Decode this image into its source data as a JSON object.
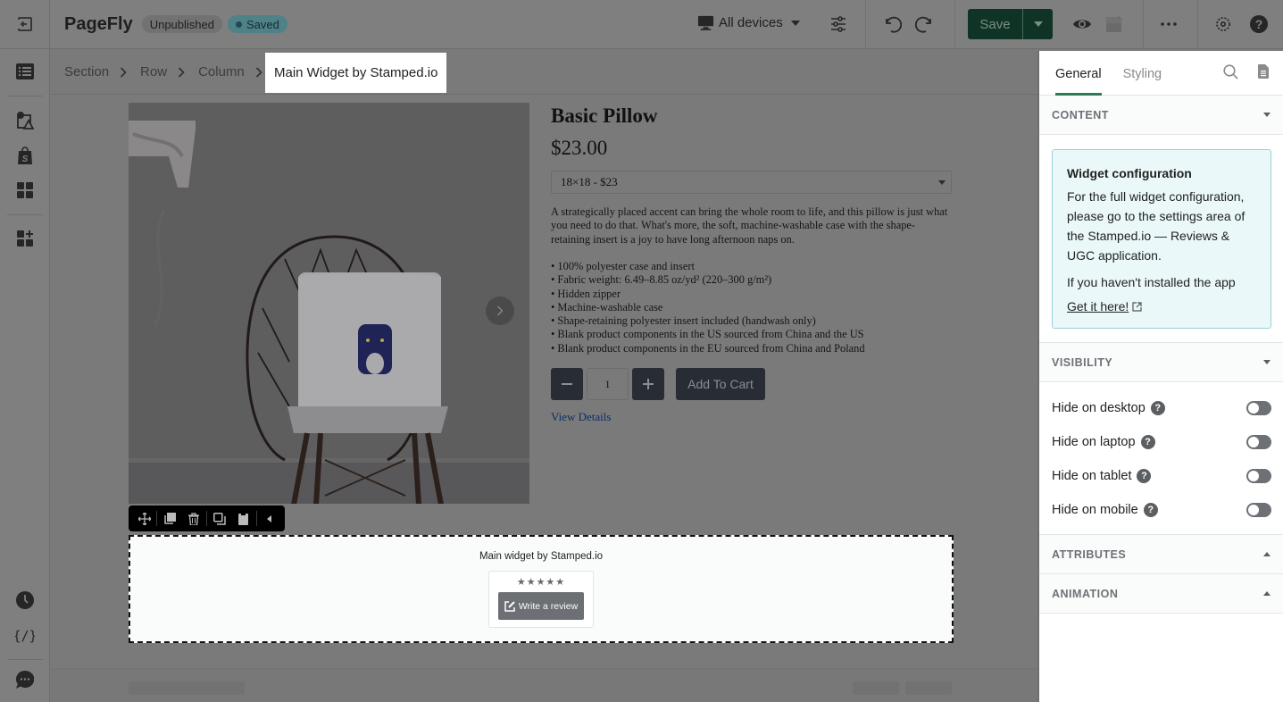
{
  "topbar": {
    "brand": "PageFly",
    "status_badge": "Unpublished",
    "saved_badge": "Saved",
    "device_selector": "All devices",
    "save_label": "Save",
    "icons": [
      "exit-icon",
      "monitor-icon",
      "sliders-icon",
      "undo-icon",
      "redo-icon",
      "caret-down-icon",
      "eye-icon",
      "preview-image-icon",
      "more-icon",
      "settings-icon",
      "help-icon"
    ]
  },
  "leftbar": {
    "items": [
      {
        "name": "layers",
        "icon": "list-icon"
      },
      {
        "name": "media",
        "icon": "image-shapes-icon"
      },
      {
        "name": "shopify",
        "icon": "shopify-bag-icon"
      },
      {
        "name": "elements",
        "icon": "grid-icon"
      },
      {
        "name": "add-elements",
        "icon": "grid-plus-icon"
      },
      {
        "name": "history",
        "icon": "clock-icon"
      },
      {
        "name": "code",
        "icon": "code-braces-icon"
      },
      {
        "name": "chat",
        "icon": "chat-icon"
      }
    ]
  },
  "breadcrumb": {
    "items": [
      "Section",
      "Row",
      "Column"
    ],
    "active": "Main Widget by Stamped.io"
  },
  "product": {
    "title": "Basic Pillow",
    "price": "$23.00",
    "variant": "18×18 - $23",
    "description": "A strategically placed accent can bring the whole room to life, and this pillow is just what you need to do that. What's more, the soft, machine-washable case with the shape-retaining insert is a joy to have long afternoon naps on.",
    "bullets": [
      "• 100% polyester case and insert",
      "• Fabric weight: 6.49–8.85 oz/yd² (220–300 g/m²)",
      "• Hidden zipper",
      "• Machine-washable case",
      "• Shape-retaining polyester insert included (handwash only)",
      "• Blank product components in the US sourced from China and the US",
      "• Blank product components in the EU sourced from China and Poland"
    ],
    "quantity": "1",
    "add_to_cart": "Add To Cart",
    "view_details": "View Details"
  },
  "element_toolbar": {
    "icons": [
      "move-icon",
      "duplicate-icon",
      "delete-icon",
      "copy-icon",
      "paste-icon",
      "collapse-left-icon"
    ]
  },
  "widget": {
    "label": "Main widget by Stamped.io",
    "stars": "★★★★★",
    "write_review": "Write a review"
  },
  "panel": {
    "tabs": [
      "General",
      "Styling"
    ],
    "active_tab": "General",
    "sections": {
      "content": {
        "title": "CONTENT",
        "info_title": "Widget configuration",
        "info_text": "For the full widget configuration, please go to the settings area of the Stamped.io — Reviews & UGC application.",
        "info_text2": "If you haven't installed the app",
        "info_link": "Get it here!"
      },
      "visibility": {
        "title": "VISIBILITY",
        "rows": [
          {
            "label": "Hide on desktop",
            "on": false
          },
          {
            "label": "Hide on laptop",
            "on": false
          },
          {
            "label": "Hide on tablet",
            "on": false
          },
          {
            "label": "Hide on mobile",
            "on": false
          }
        ]
      },
      "attributes": {
        "title": "ATTRIBUTES"
      },
      "animation": {
        "title": "ANIMATION"
      }
    }
  },
  "colors": {
    "accent": "#2e7a57",
    "save_bg": "#0f3324",
    "info_bg": "#eaf8f9",
    "info_border": "#98d3d6",
    "overlay": "#7a7a7a"
  }
}
